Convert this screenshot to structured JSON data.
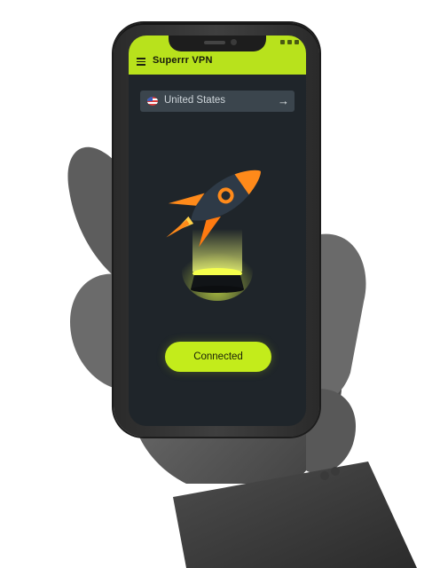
{
  "app": {
    "title": "Superrr VPN"
  },
  "location": {
    "country": "United States",
    "flag_icon": "us-flag-icon",
    "action_icon": "arrow-right-icon"
  },
  "connection": {
    "button_label": "Connected",
    "status": "connected"
  },
  "colors": {
    "accent": "#c3ec1b",
    "screen_bg": "#1f252a",
    "rocket": "#ff8a1a"
  }
}
